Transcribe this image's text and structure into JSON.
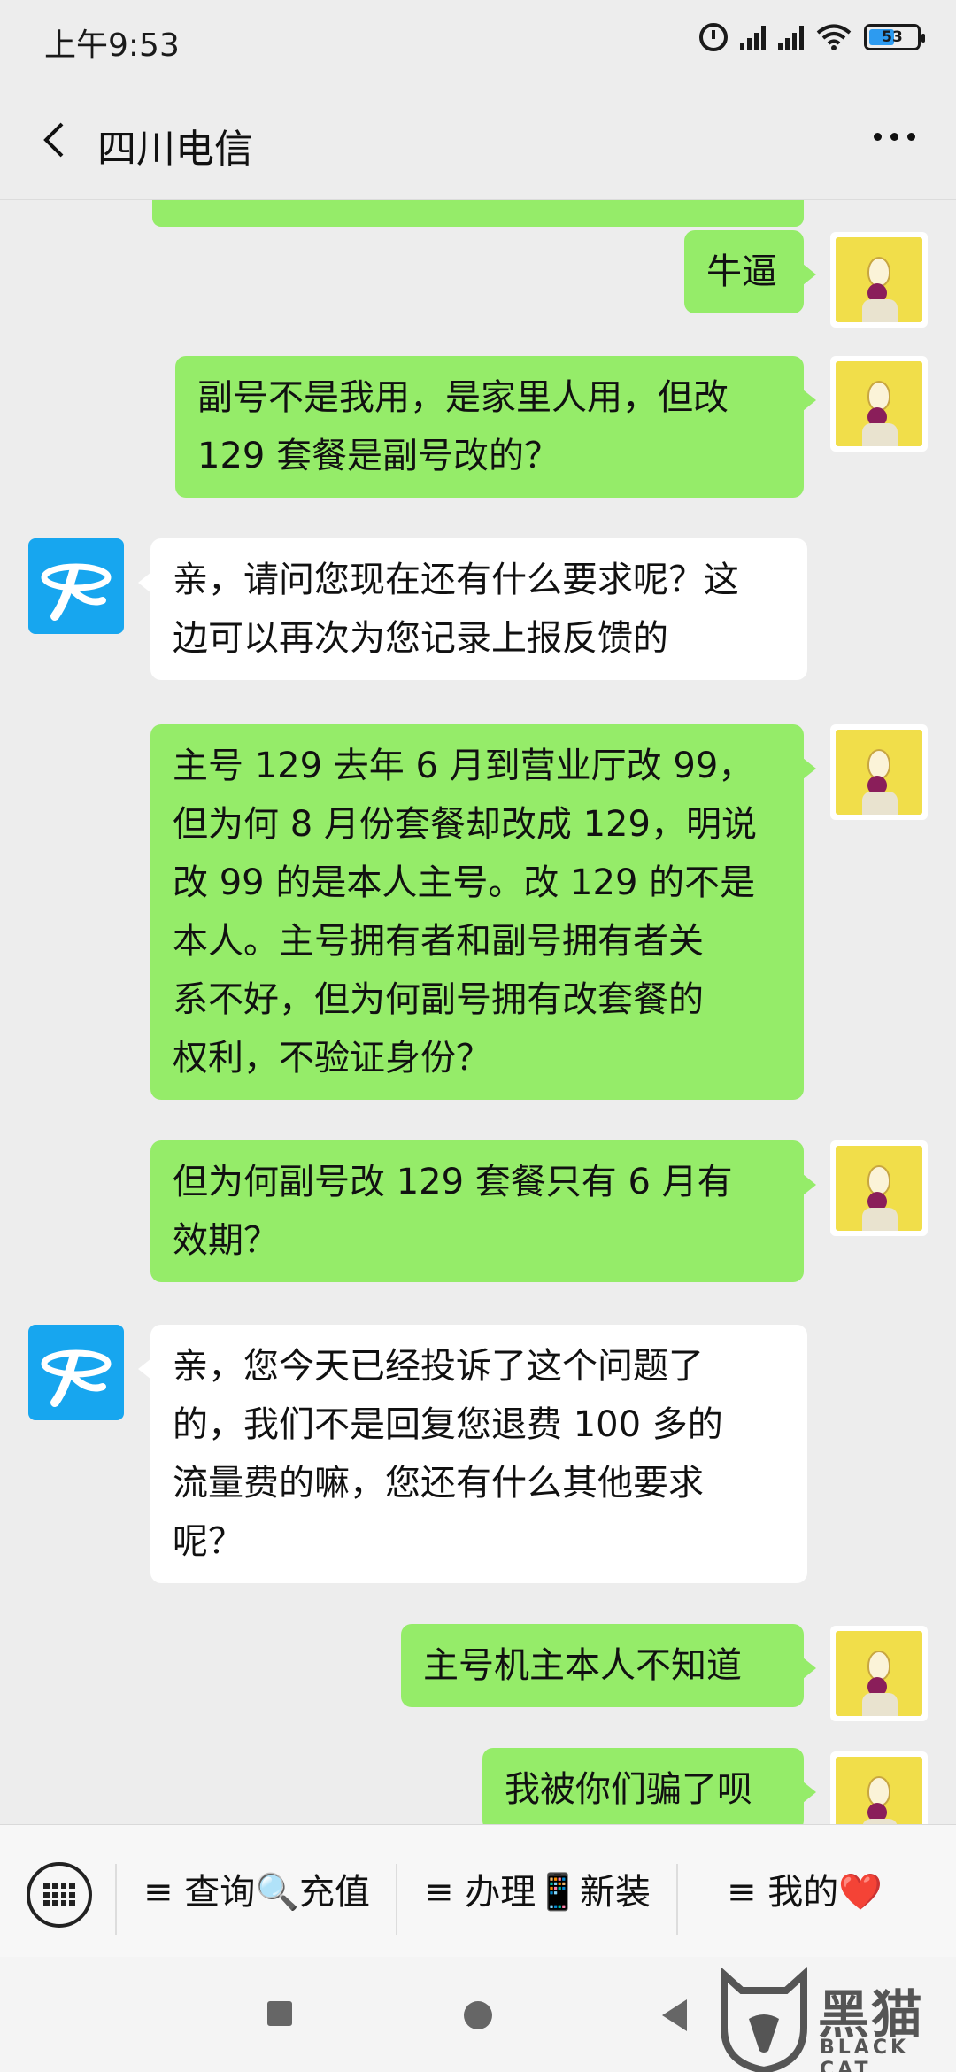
{
  "status_bar": {
    "time": "上午9:53",
    "battery": "53",
    "battery_level": 0.53,
    "icons": [
      "alarm-icon",
      "signal-icon",
      "signal-icon",
      "wifi-icon",
      "battery-icon"
    ]
  },
  "header": {
    "title": "四川电信",
    "back_icon": "back-arrow-icon",
    "more_icon": "more-dots-icon"
  },
  "colors": {
    "background": "#ededed",
    "bubble_sent": "#95ec69",
    "bubble_received": "#ffffff",
    "bot_avatar": "#17a6ef",
    "avatar_user": "#f1de4a"
  },
  "messages": [
    {
      "from": "me",
      "lines": [
        "牛逼"
      ]
    },
    {
      "from": "me",
      "lines": [
        "副号不是我用，是家里人用，但改",
        "129 套餐是副号改的？"
      ]
    },
    {
      "from": "bot",
      "lines": [
        "亲，请问您现在还有什么要求呢？这",
        "边可以再次为您记录上报反馈的"
      ]
    },
    {
      "from": "me",
      "lines": [
        "主号 129 去年 6 月到营业厅改 99，",
        "但为何 8 月份套餐却改成 129，明说",
        "改 99 的是本人主号。改 129 的不是",
        "本人。主号拥有者和副号拥有者关",
        "系不好，但为何副号拥有改套餐的",
        "权利，不验证身份？"
      ]
    },
    {
      "from": "me",
      "lines": [
        "但为何副号改 129 套餐只有 6 月有",
        "效期？"
      ]
    },
    {
      "from": "bot",
      "lines": [
        "亲，您今天已经投诉了这个问题了",
        "的，我们不是回复您退费 100 多的",
        "流量费的嘛，您还有什么其他要求",
        "呢？"
      ]
    },
    {
      "from": "me",
      "lines": [
        "主号机主本人不知道"
      ]
    },
    {
      "from": "me",
      "lines": [
        "我被你们骗了呗"
      ]
    }
  ],
  "menu": {
    "keyboard_icon": "keyboard-icon",
    "items": [
      {
        "label": "≡ 查询🔍充值"
      },
      {
        "label": "≡ 办理📱新装"
      },
      {
        "label": "≡ 我的❤️"
      }
    ]
  },
  "system_nav": {
    "icons": [
      "recents-icon",
      "home-icon",
      "back-icon"
    ]
  },
  "watermark": {
    "title": "黑猫",
    "subtitle": "BLACK CAT"
  }
}
